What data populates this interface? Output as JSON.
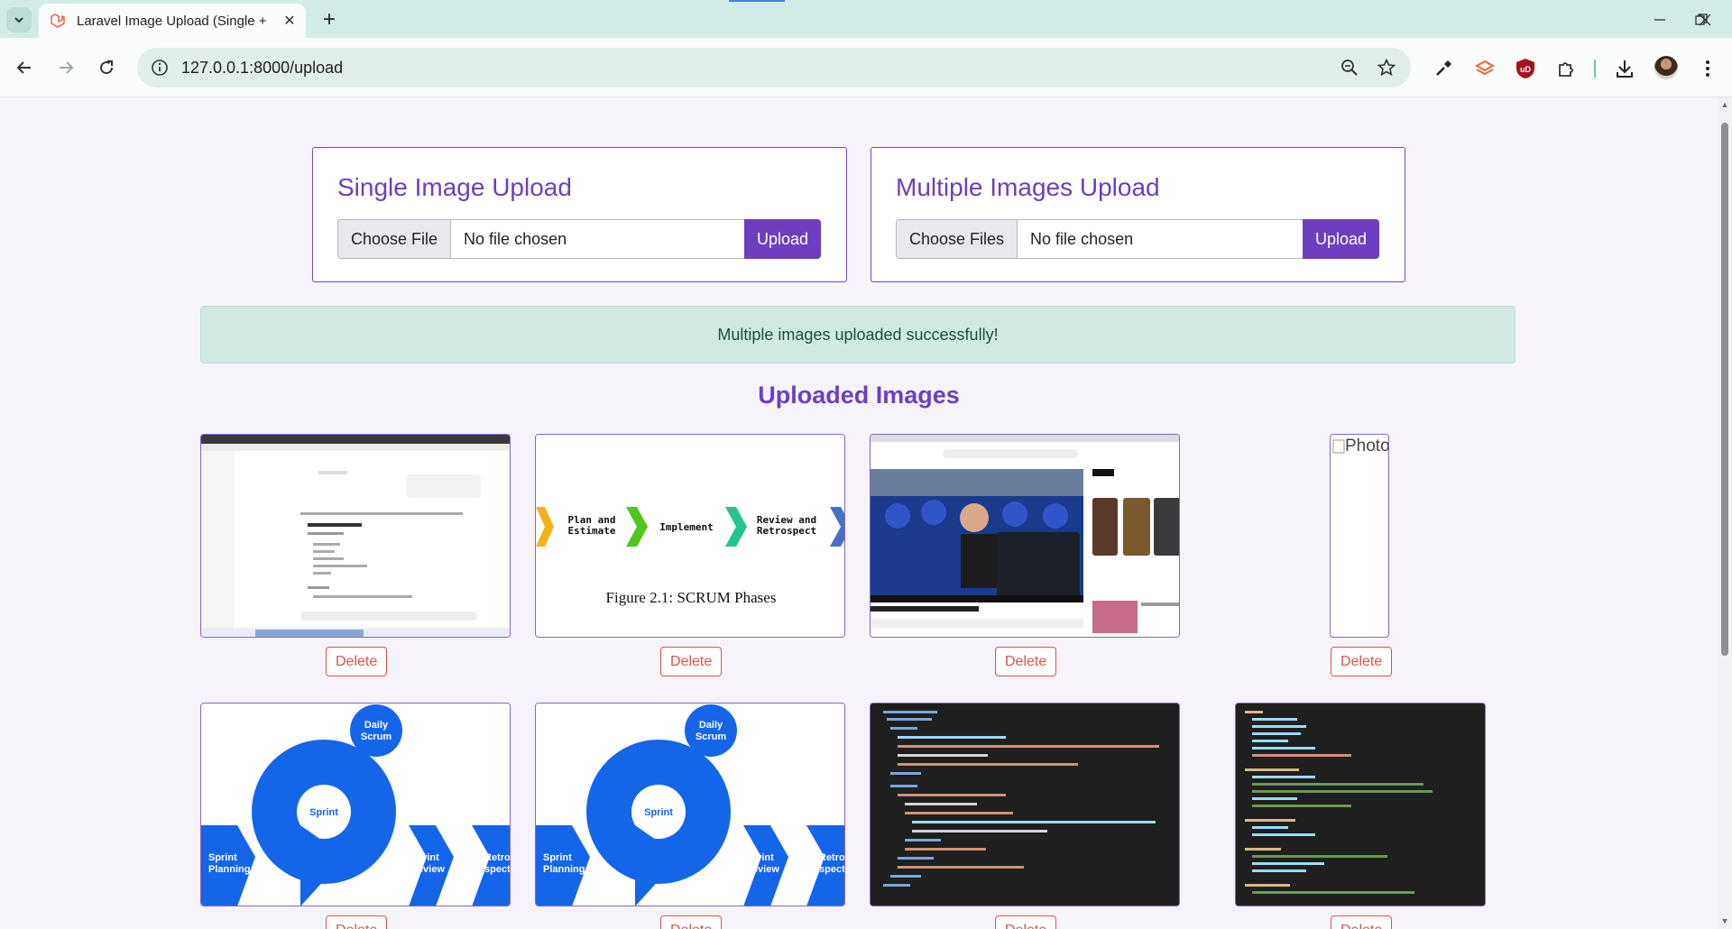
{
  "browser": {
    "tab_title": "Laravel Image Upload (Single +",
    "url": "127.0.0.1:8000/upload"
  },
  "single_upload": {
    "title": "Single Image Upload",
    "choose_label": "Choose File",
    "status": "No file chosen",
    "upload_label": "Upload"
  },
  "multiple_upload": {
    "title": "Multiple Images Upload",
    "choose_label": "Choose Files",
    "status": "No file chosen",
    "upload_label": "Upload"
  },
  "alert": {
    "message": "Multiple images uploaded successfully!"
  },
  "gallery": {
    "title": "Uploaded Images",
    "delete_label": "Delete",
    "broken_alt": "Photo",
    "scrum_phases": {
      "caption": "Figure 2.1: SCRUM Phases",
      "plan": "Plan and",
      "estimate": "Estimate",
      "implement": "Implement",
      "review": "Review and",
      "retrospect": "Retrospect"
    },
    "sprint_diagram": {
      "daily": "Daily",
      "scrum": "Scrum",
      "sprint": "Sprint",
      "planning": "Planning",
      "review": "Review",
      "retro": "Retro-",
      "spective": "spective"
    }
  }
}
